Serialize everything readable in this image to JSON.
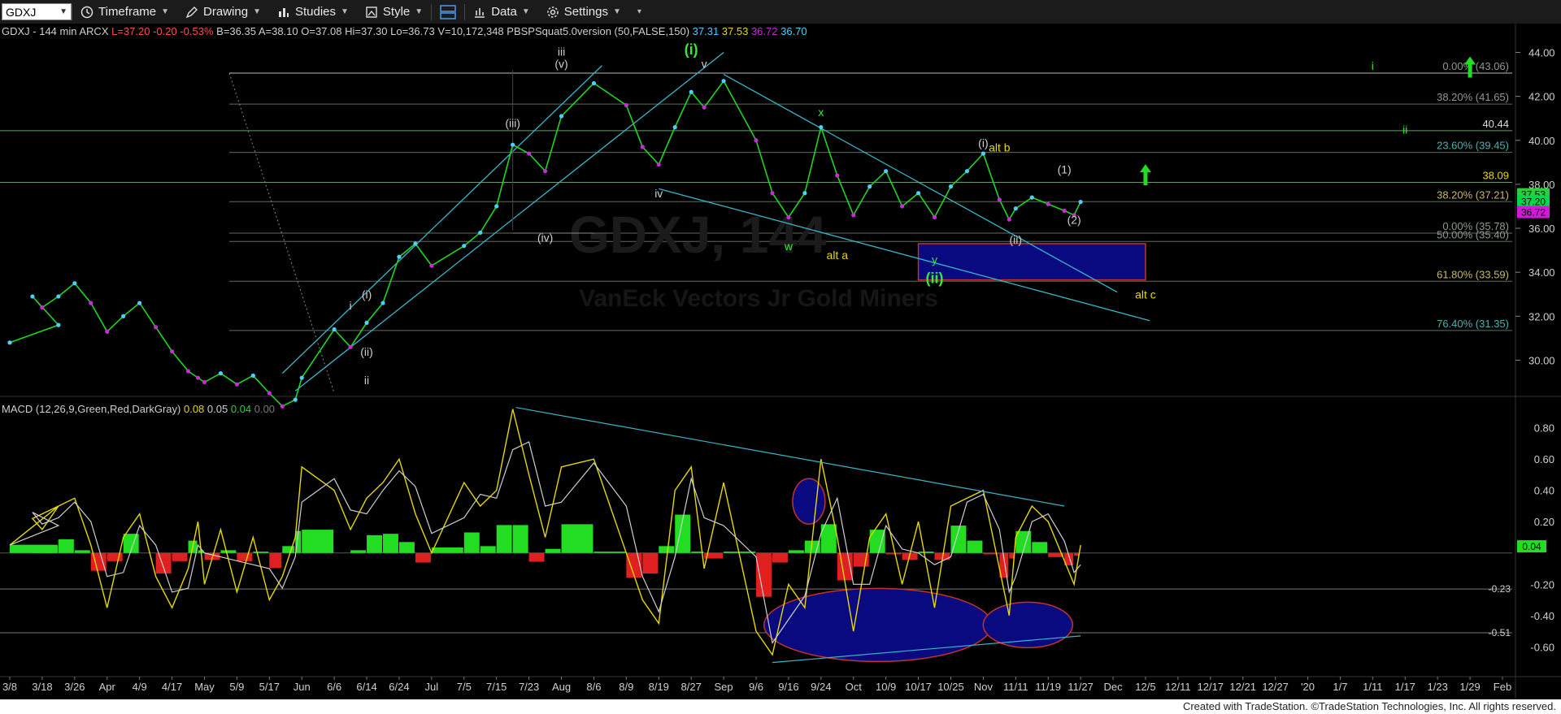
{
  "toolbar": {
    "symbol": "GDXJ",
    "timeframe": "Timeframe",
    "drawing": "Drawing",
    "studies": "Studies",
    "style": "Style",
    "data": "Data",
    "settings": "Settings"
  },
  "footer": "Created with TradeStation. ©TradeStation Technologies, Inc. All rights reserved.",
  "chart_data": [
    {
      "type": "line",
      "panel": "price",
      "header": {
        "name": "GDXJ - 144 min  ARCX",
        "L": "L=37.20",
        "chg": "-0.20",
        "pct": "-0.53%",
        "B": "B=36.35",
        "A": "A=38.10",
        "O": "O=37.08",
        "Hi": "Hi=37.30",
        "Lo": "Lo=36.73",
        "V": "V=10,172,348",
        "study": "PBSPSquat5.0version (50,FALSE,150)",
        "study_vals": [
          "37.31",
          "37.53",
          "36.72",
          "36.70"
        ]
      },
      "watermark": "GDXJ, 144",
      "watermark_sub": "VanEck Vectors Jr Gold Miners",
      "y_ticks": [
        "44.00",
        "42.00",
        "40.00",
        "38.00",
        "36.00",
        "34.00",
        "32.00",
        "30.00"
      ],
      "ylim": [
        28.5,
        44.5
      ],
      "x_tick_labels": [
        "3/8",
        "3/18",
        "3/26",
        "Apr",
        "4/9",
        "4/17",
        "May",
        "5/9",
        "5/17",
        "Jun",
        "6/6",
        "6/14",
        "6/24",
        "Jul",
        "7/5",
        "7/15",
        "7/23",
        "Aug",
        "8/6",
        "8/9",
        "8/19",
        "8/27",
        "Sep",
        "9/6",
        "9/16",
        "9/24",
        "Oct",
        "10/9",
        "10/17",
        "10/25",
        "Nov",
        "11/11",
        "11/19",
        "11/27",
        "Dec",
        "12/5",
        "12/11",
        "12/17",
        "12/21",
        "12/27",
        "'20",
        "1/7",
        "1/11",
        "1/17",
        "1/23",
        "1/29",
        "Feb"
      ],
      "price_series": [
        [
          "3/8",
          30.8
        ],
        [
          "3/12",
          31.6
        ],
        [
          "3/15",
          32.9
        ],
        [
          "3/18",
          32.4
        ],
        [
          "3/21",
          32.9
        ],
        [
          "3/26",
          33.5
        ],
        [
          "3/29",
          32.6
        ],
        [
          "Apr",
          31.3
        ],
        [
          "4/4",
          32.0
        ],
        [
          "4/9",
          32.6
        ],
        [
          "4/12",
          31.5
        ],
        [
          "4/17",
          30.4
        ],
        [
          "4/22",
          29.5
        ],
        [
          "4/26",
          29.2
        ],
        [
          "May",
          29.0
        ],
        [
          "5/5",
          29.4
        ],
        [
          "5/9",
          28.9
        ],
        [
          "5/13",
          29.3
        ],
        [
          "5/17",
          28.5
        ],
        [
          "5/22",
          27.9
        ],
        [
          "5/28",
          28.2
        ],
        [
          "Jun",
          29.2
        ],
        [
          "6/6",
          31.4
        ],
        [
          "6/10",
          30.6
        ],
        [
          "6/14",
          31.7
        ],
        [
          "6/18",
          32.6
        ],
        [
          "6/24",
          34.7
        ],
        [
          "6/28",
          35.3
        ],
        [
          "Jul",
          34.3
        ],
        [
          "7/5",
          35.2
        ],
        [
          "7/10",
          35.8
        ],
        [
          "7/15",
          37.0
        ],
        [
          "7/19",
          39.8
        ],
        [
          "7/23",
          39.4
        ],
        [
          "7/29",
          38.6
        ],
        [
          "Aug",
          41.1
        ],
        [
          "8/6",
          42.6
        ],
        [
          "8/9",
          41.6
        ],
        [
          "8/14",
          39.7
        ],
        [
          "8/19",
          38.9
        ],
        [
          "8/23",
          40.6
        ],
        [
          "8/27",
          42.2
        ],
        [
          "8/30",
          41.5
        ],
        [
          "Sep",
          42.7
        ],
        [
          "9/6",
          40.0
        ],
        [
          "9/11",
          37.6
        ],
        [
          "9/16",
          36.5
        ],
        [
          "9/20",
          37.6
        ],
        [
          "9/24",
          40.6
        ],
        [
          "9/27",
          38.4
        ],
        [
          "Oct",
          36.6
        ],
        [
          "10/4",
          37.9
        ],
        [
          "10/9",
          38.6
        ],
        [
          "10/14",
          37.0
        ],
        [
          "10/17",
          37.6
        ],
        [
          "10/21",
          36.5
        ],
        [
          "10/25",
          37.9
        ],
        [
          "10/29",
          38.6
        ],
        [
          "Nov",
          39.4
        ],
        [
          "11/5",
          37.3
        ],
        [
          "11/8",
          36.4
        ],
        [
          "11/11",
          36.9
        ],
        [
          "11/15",
          37.4
        ],
        [
          "11/19",
          37.1
        ],
        [
          "11/22",
          36.8
        ],
        [
          "11/25",
          36.6
        ],
        [
          "11/27",
          37.2
        ]
      ],
      "horizontal_lines": [
        {
          "label": "0.00% (43.06)",
          "value": 43.06
        },
        {
          "label": "38.20% (41.65)",
          "value": 41.65
        },
        {
          "label": "23.60% (39.45)",
          "value": 39.45
        },
        {
          "label": "38.20% (37.21)",
          "value": 37.21
        },
        {
          "label": "0.00% (35.78)",
          "value": 35.78
        },
        {
          "label": "50.00% (35.40)",
          "value": 35.4
        },
        {
          "label": "61.80% (33.59)",
          "value": 33.59
        },
        {
          "label": "76.40% (31.35)",
          "value": 31.35
        },
        {
          "label": "",
          "value": 40.44
        },
        {
          "label": "",
          "value": 38.09
        }
      ],
      "level_tags": [
        {
          "text": "40.44",
          "value": 40.44
        },
        {
          "text": "38.09",
          "value": 38.09
        }
      ],
      "price_tags": [
        {
          "text": "37.53",
          "value": 37.53,
          "color": "#2ecc40"
        },
        {
          "text": "37.20",
          "value": 37.2,
          "color": "#00d84a"
        },
        {
          "text": "36.72",
          "value": 36.72,
          "color": "#d21ad6"
        }
      ],
      "wave_labels": [
        {
          "text": "iii",
          "date": "Aug",
          "y": 43.85,
          "color": "#cfcfcf"
        },
        {
          "text": "(v)",
          "date": "Aug",
          "y": 43.3,
          "color": "#cfcfcf"
        },
        {
          "text": "(i)",
          "date": "8/27",
          "y": 43.9,
          "color": "#39e639",
          "big": true
        },
        {
          "text": "v",
          "date": "8/30",
          "y": 43.3,
          "color": "#cfcfcf"
        },
        {
          "text": "(iii)",
          "date": "7/19",
          "y": 40.6,
          "color": "#cfcfcf"
        },
        {
          "text": "iv",
          "date": "8/19",
          "y": 37.4,
          "color": "#cfcfcf"
        },
        {
          "text": "(iv)",
          "date": "7/29",
          "y": 35.4,
          "color": "#cfcfcf"
        },
        {
          "text": "x",
          "date": "9/24",
          "y": 41.1,
          "color": "#39e639"
        },
        {
          "text": "w",
          "date": "9/16",
          "y": 35.0,
          "color": "#39e639"
        },
        {
          "text": "alt a",
          "date": "9/27",
          "y": 34.6,
          "color": "#e6d800"
        },
        {
          "text": "y",
          "date": "10/21",
          "y": 34.4,
          "color": "#39e639"
        },
        {
          "text": "(ii)",
          "date": "10/21",
          "y": 33.5,
          "color": "#39e639",
          "big": true
        },
        {
          "text": "(i)",
          "date": "Nov",
          "y": 39.7,
          "color": "#cfcfcf"
        },
        {
          "text": "alt b",
          "date": "11/5",
          "y": 39.5,
          "color": "#e6d800"
        },
        {
          "text": "(1)",
          "date": "11/22",
          "y": 38.5,
          "color": "#cfcfcf"
        },
        {
          "text": "(ii)",
          "date": "11/11",
          "y": 35.3,
          "color": "#cfcfcf"
        },
        {
          "text": "(2)",
          "date": "11/25",
          "y": 36.2,
          "color": "#cfcfcf"
        },
        {
          "text": "alt c",
          "date": "12/5",
          "y": 32.8,
          "color": "#e6d800"
        },
        {
          "text": "i",
          "date": "6/10",
          "y": 32.3,
          "color": "#cfcfcf"
        },
        {
          "text": "(i)",
          "date": "6/14",
          "y": 32.8,
          "color": "#cfcfcf"
        },
        {
          "text": "(ii)",
          "date": "6/14",
          "y": 30.2,
          "color": "#cfcfcf"
        },
        {
          "text": "ii",
          "date": "6/14",
          "y": 28.9,
          "color": "#cfcfcf"
        },
        {
          "text": "i",
          "date": "1/11",
          "y": 43.2,
          "color": "#39e639"
        },
        {
          "text": "ii",
          "date": "1/17",
          "y": 40.3,
          "color": "#39e639"
        }
      ],
      "up_arrows": [
        {
          "date": "1/29",
          "y": 43.3
        },
        {
          "date": "12/5",
          "y": 38.4
        }
      ],
      "target_box": {
        "from": "10/17",
        "to": "12/5",
        "top": 35.3,
        "bottom": 33.65
      }
    },
    {
      "type": "line",
      "panel": "macd",
      "title": "MACD (12,26,9,Green,Red,DarkGray)",
      "header_vals": [
        {
          "text": "0.08",
          "color": "#e6d800"
        },
        {
          "text": "0.05",
          "color": "#d0d0d0"
        },
        {
          "text": "0.04",
          "color": "#2ecc40"
        },
        {
          "text": "0.00",
          "color": "#777777"
        }
      ],
      "y_ticks": [
        "0.80",
        "0.60",
        "0.40",
        "0.20",
        "-0.20",
        "-0.40",
        "-0.60"
      ],
      "ylim": [
        -0.78,
        0.98
      ],
      "value_tags": [
        {
          "text": "0.04",
          "value": 0.04
        },
        {
          "text": "-0.23",
          "value": -0.23
        },
        {
          "text": "-0.51",
          "value": -0.51
        }
      ],
      "macd_series": [
        [
          "3/8",
          0.05
        ],
        [
          "3/12",
          0.3
        ],
        [
          "3/15",
          0.22
        ],
        [
          "3/18",
          0.15
        ],
        [
          "3/21",
          0.3
        ],
        [
          "3/26",
          0.35
        ],
        [
          "3/29",
          0.05
        ],
        [
          "Apr",
          -0.35
        ],
        [
          "4/4",
          0.1
        ],
        [
          "4/9",
          0.25
        ],
        [
          "4/12",
          -0.15
        ],
        [
          "4/17",
          -0.35
        ],
        [
          "4/22",
          -0.1
        ],
        [
          "4/26",
          0.2
        ],
        [
          "May",
          -0.2
        ],
        [
          "5/5",
          0.15
        ],
        [
          "5/9",
          -0.25
        ],
        [
          "5/13",
          0.1
        ],
        [
          "5/17",
          -0.3
        ],
        [
          "5/22",
          -0.15
        ],
        [
          "5/28",
          0.1
        ],
        [
          "Jun",
          0.55
        ],
        [
          "6/6",
          0.4
        ],
        [
          "6/10",
          0.15
        ],
        [
          "6/14",
          0.35
        ],
        [
          "6/18",
          0.45
        ],
        [
          "6/24",
          0.6
        ],
        [
          "6/28",
          0.25
        ],
        [
          "Jul",
          0.0
        ],
        [
          "7/5",
          0.45
        ],
        [
          "7/10",
          0.3
        ],
        [
          "7/15",
          0.4
        ],
        [
          "7/19",
          0.92
        ],
        [
          "7/23",
          0.5
        ],
        [
          "7/29",
          0.1
        ],
        [
          "Aug",
          0.55
        ],
        [
          "8/6",
          0.6
        ],
        [
          "8/9",
          0.0
        ],
        [
          "8/14",
          -0.3
        ],
        [
          "8/19",
          -0.45
        ],
        [
          "8/23",
          0.4
        ],
        [
          "8/27",
          0.55
        ],
        [
          "8/30",
          -0.1
        ],
        [
          "Sep",
          0.45
        ],
        [
          "9/6",
          -0.5
        ],
        [
          "9/11",
          -0.65
        ],
        [
          "9/16",
          -0.2
        ],
        [
          "9/20",
          -0.35
        ],
        [
          "9/24",
          0.6
        ],
        [
          "9/27",
          0.1
        ],
        [
          "Oct",
          -0.5
        ],
        [
          "10/4",
          0.1
        ],
        [
          "10/9",
          0.25
        ],
        [
          "10/14",
          -0.2
        ],
        [
          "10/17",
          0.2
        ],
        [
          "10/21",
          -0.35
        ],
        [
          "10/25",
          0.3
        ],
        [
          "10/29",
          0.35
        ],
        [
          "Nov",
          0.4
        ],
        [
          "11/5",
          -0.1
        ],
        [
          "11/8",
          -0.4
        ],
        [
          "11/11",
          0.1
        ],
        [
          "11/15",
          0.3
        ],
        [
          "11/19",
          0.2
        ],
        [
          "11/22",
          -0.05
        ],
        [
          "11/25",
          -0.2
        ],
        [
          "11/27",
          0.05
        ]
      ]
    }
  ]
}
